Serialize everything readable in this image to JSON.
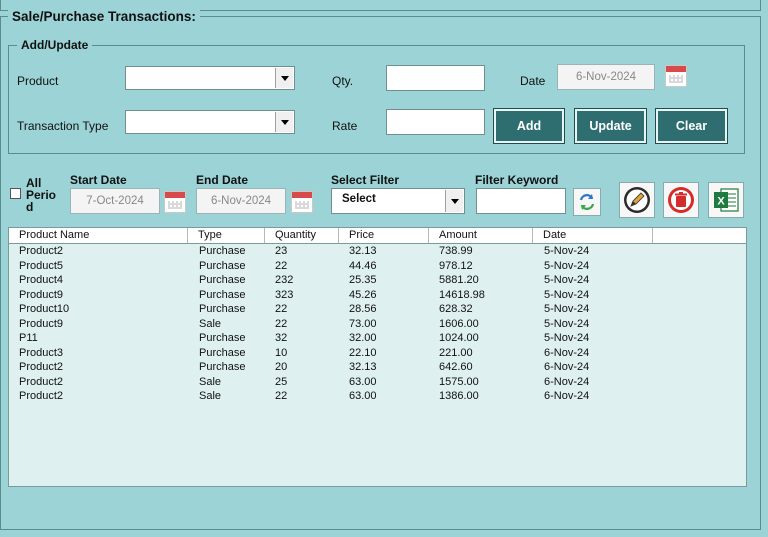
{
  "main": {
    "title": "Sale/Purchase Transactions:"
  },
  "add_update": {
    "title": "Add/Update",
    "product_label": "Product",
    "qty_label": "Qty.",
    "date_label": "Date",
    "date_value": "6-Nov-2024",
    "transaction_type_label": "Transaction Type",
    "rate_label": "Rate",
    "add_label": "Add",
    "update_label": "Update",
    "clear_label": "Clear"
  },
  "filters": {
    "all_period_line1": "All",
    "all_period_line2": "Perio",
    "all_period_line3": "d",
    "start_date_label": "Start Date",
    "start_date_value": "7-Oct-2024",
    "end_date_label": "End Date",
    "end_date_value": "6-Nov-2024",
    "select_filter_label": "Select Filter",
    "select_filter_value": "Select",
    "filter_keyword_label": "Filter Keyword"
  },
  "table": {
    "columns": [
      "Product Name",
      "Type",
      "Quantity",
      "Price",
      "Amount",
      "Date"
    ],
    "rows": [
      [
        "Product2",
        "Purchase",
        "23",
        "32.13",
        "738.99",
        "5-Nov-24"
      ],
      [
        "Product5",
        "Purchase",
        "22",
        "44.46",
        "978.12",
        "5-Nov-24"
      ],
      [
        "Product4",
        "Purchase",
        "232",
        "25.35",
        "5881.20",
        "5-Nov-24"
      ],
      [
        "Product9",
        "Purchase",
        "323",
        "45.26",
        "14618.98",
        "5-Nov-24"
      ],
      [
        "Product10",
        "Purchase",
        "22",
        "28.56",
        "628.32",
        "5-Nov-24"
      ],
      [
        "Product9",
        "Sale",
        "22",
        "73.00",
        "1606.00",
        "5-Nov-24"
      ],
      [
        "P11",
        "Purchase",
        "32",
        "32.00",
        "1024.00",
        "5-Nov-24"
      ],
      [
        "Product3",
        "Purchase",
        "10",
        "22.10",
        "221.00",
        "6-Nov-24"
      ],
      [
        "Product2",
        "Purchase",
        "20",
        "32.13",
        "642.60",
        "6-Nov-24"
      ],
      [
        "Product2",
        "Sale",
        "25",
        "63.00",
        "1575.00",
        "6-Nov-24"
      ],
      [
        "Product2",
        "Sale",
        "22",
        "63.00",
        "1386.00",
        "6-Nov-24"
      ]
    ]
  },
  "icons": {
    "refresh": "refresh-icon",
    "edit": "edit-icon",
    "delete": "delete-icon",
    "excel": "excel-icon",
    "excel_letter": "X"
  },
  "colors": {
    "background": "#9bd3d6",
    "button": "#2e6e70",
    "grid_background": "#dff0f1"
  }
}
